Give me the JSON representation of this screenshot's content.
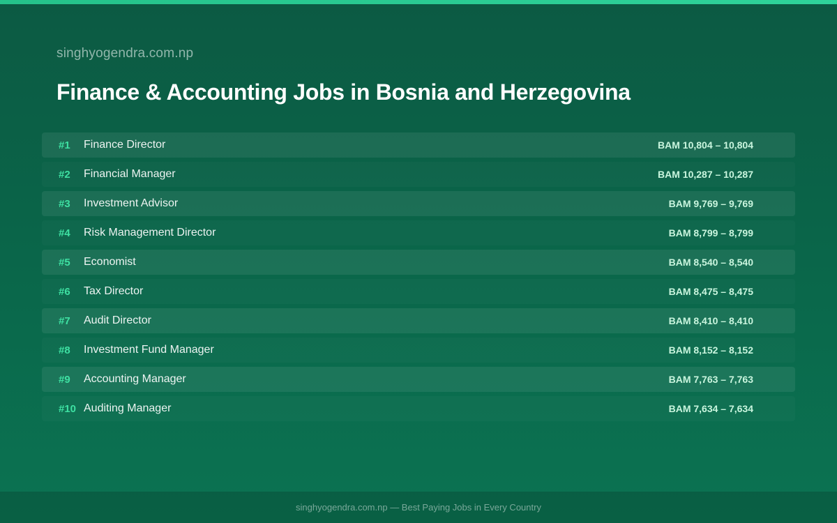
{
  "site_name": "singhyogendra.com.np",
  "title": "Finance & Accounting Jobs in Bosnia and Herzegovina",
  "colors": {
    "accent_bar": "#25c28a",
    "rank": "#3ee0a2",
    "salary": "#c9f5de",
    "background": "#0a6549"
  },
  "jobs": [
    {
      "rank": "#1",
      "title": "Finance Director",
      "salary": "BAM 10,804 – 10,804"
    },
    {
      "rank": "#2",
      "title": "Financial Manager",
      "salary": "BAM 10,287 – 10,287"
    },
    {
      "rank": "#3",
      "title": "Investment Advisor",
      "salary": "BAM 9,769 – 9,769"
    },
    {
      "rank": "#4",
      "title": "Risk Management Director",
      "salary": "BAM 8,799 – 8,799"
    },
    {
      "rank": "#5",
      "title": "Economist",
      "salary": "BAM 8,540 – 8,540"
    },
    {
      "rank": "#6",
      "title": "Tax Director",
      "salary": "BAM 8,475 – 8,475"
    },
    {
      "rank": "#7",
      "title": "Audit Director",
      "salary": "BAM 8,410 – 8,410"
    },
    {
      "rank": "#8",
      "title": "Investment Fund Manager",
      "salary": "BAM 8,152 – 8,152"
    },
    {
      "rank": "#9",
      "title": "Accounting Manager",
      "salary": "BAM 7,763 – 7,763"
    },
    {
      "rank": "#10",
      "title": "Auditing Manager",
      "salary": "BAM 7,634 – 7,634"
    }
  ],
  "footer": "singhyogendra.com.np — Best Paying Jobs in Every Country"
}
